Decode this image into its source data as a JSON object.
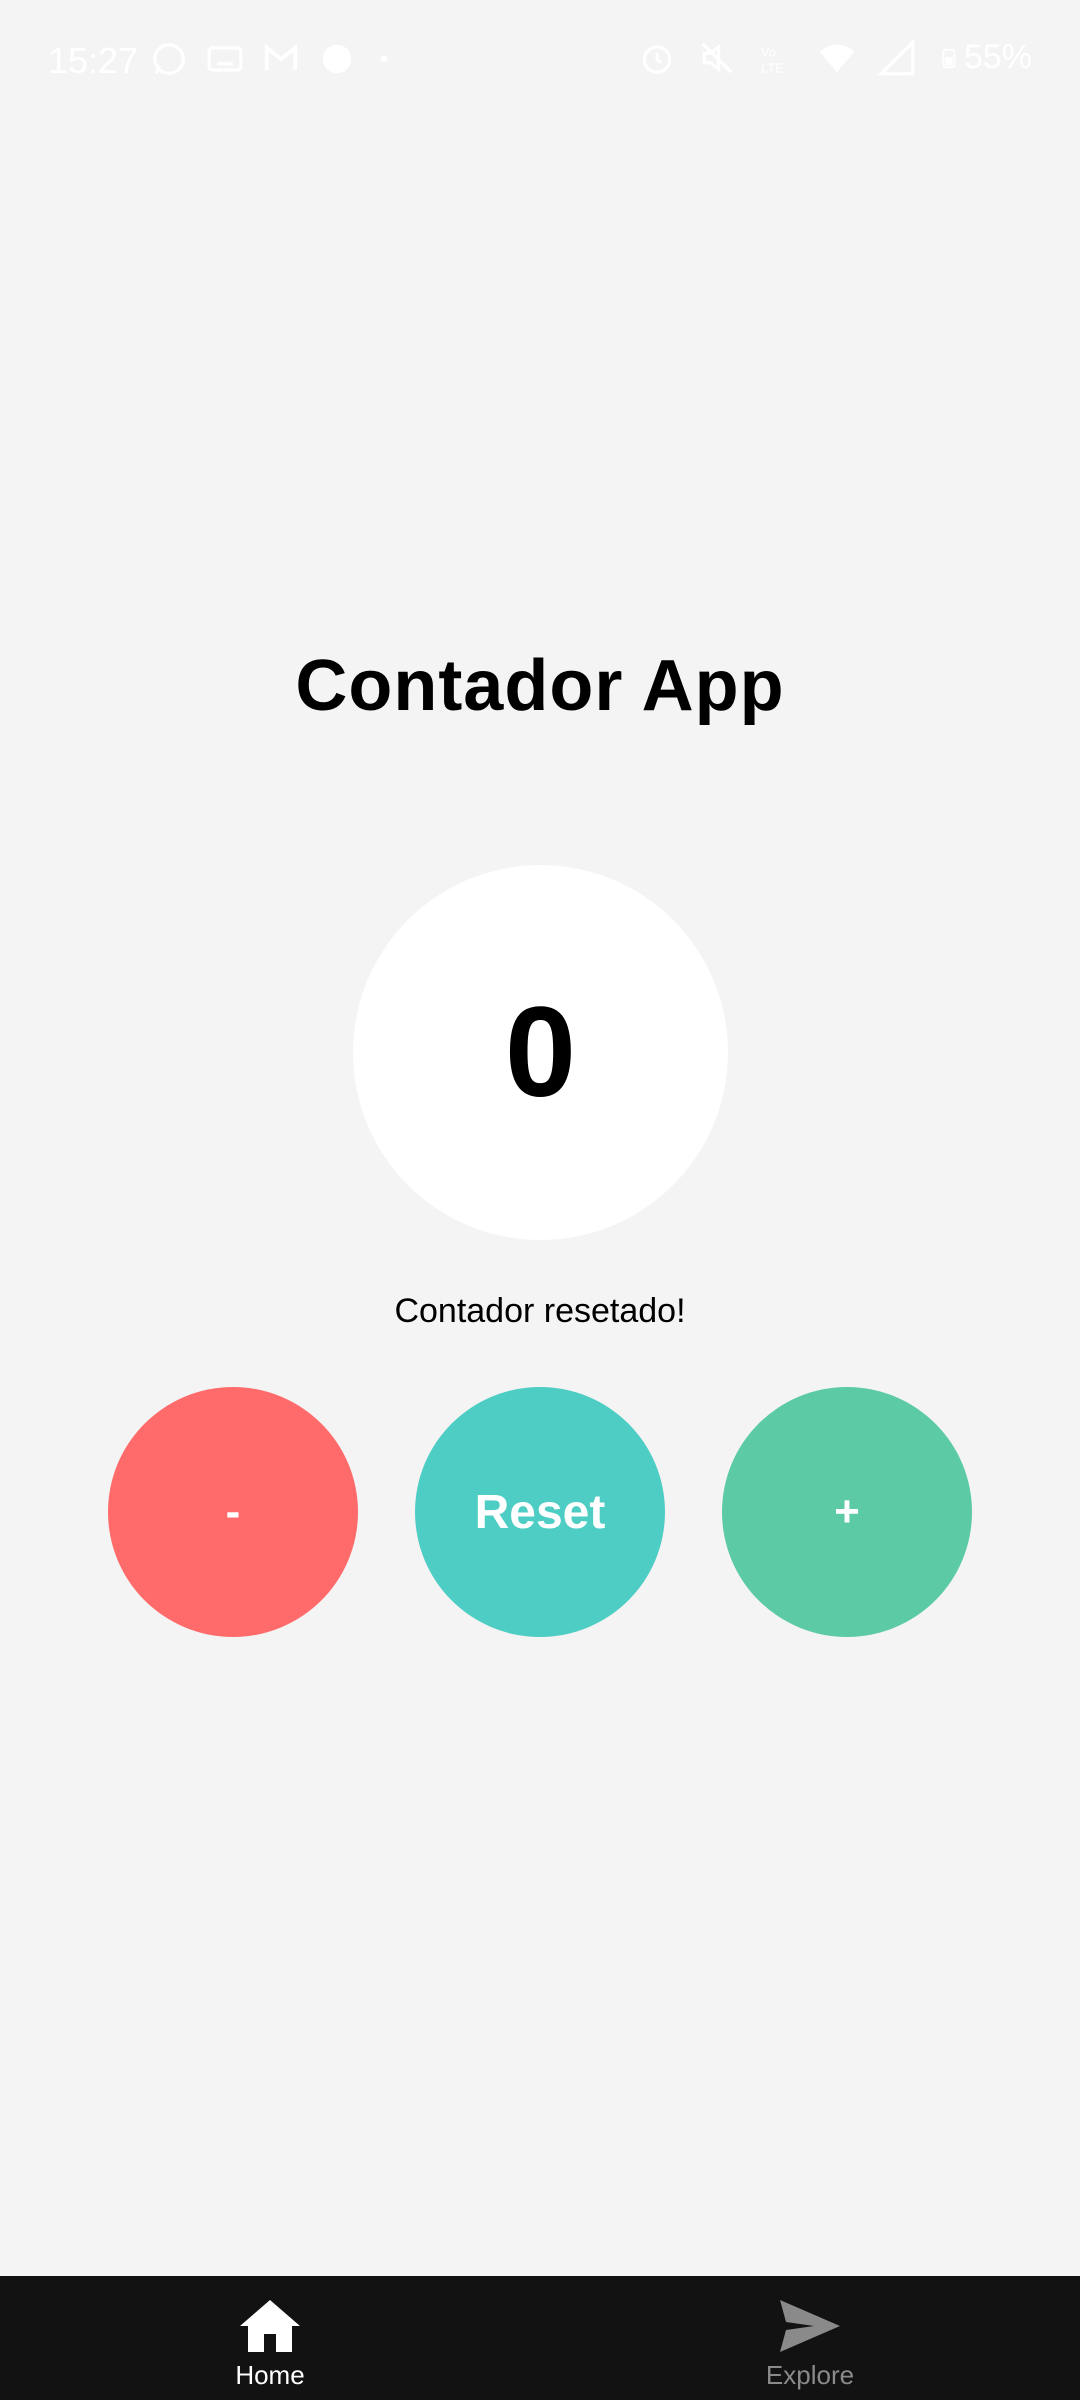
{
  "status_bar": {
    "time": "15:27",
    "battery": "55%",
    "left_icons": [
      "whatsapp-icon",
      "keyboard-icon",
      "gmail-icon",
      "globe-icon",
      "dot-icon"
    ],
    "right_icons": [
      "alarm-icon",
      "mute-icon",
      "volte-icon",
      "wifi-icon",
      "signal-icon",
      "battery-icon"
    ]
  },
  "app": {
    "title": "Contador App",
    "counter": "0",
    "message": "Contador resetado!"
  },
  "buttons": {
    "decrement": "-",
    "reset": "Reset",
    "increment": "+"
  },
  "colors": {
    "decrement": "#ff6b6b",
    "reset": "#4ecdc4",
    "increment": "#5ccaa4",
    "background": "#f4f4f4",
    "nav_background": "#121212"
  },
  "nav": {
    "home_label": "Home",
    "explore_label": "Explore",
    "home_icon": "home-icon",
    "explore_icon": "send-icon"
  }
}
